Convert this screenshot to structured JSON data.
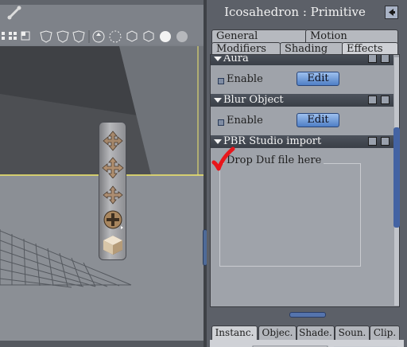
{
  "panel": {
    "title": "Icosahedron : Primitive",
    "tabs_row1": [
      "General",
      "Motion"
    ],
    "tabs_row2": [
      "Modifiers",
      "Shading",
      "Effects"
    ],
    "active_tab": "Effects"
  },
  "sections": [
    {
      "title": "Aura",
      "checkbox_label": "Enable",
      "button_label": "Edit"
    },
    {
      "title": "Blur Object",
      "checkbox_label": "Enable",
      "button_label": "Edit"
    },
    {
      "title": "PBR Studio import",
      "drop_label": "Drop Duf file here"
    }
  ],
  "bottom_tabs": [
    "Instanc.",
    "Objec.",
    "Shade.",
    "Soun.",
    "Clip."
  ],
  "colors": {
    "accent": "#4363a3",
    "checkmark": "#e8161b",
    "viewport_bg": "#7b7f86",
    "panel_bg": "#5c6068"
  },
  "toolbar_icons": [
    "grid-layout-icon",
    "layout-icon",
    "shading-icon",
    "shading-icon",
    "shading-icon",
    "navigate-icon",
    "move-icon",
    "cube-icon",
    "sphere-icon",
    "sphere-icon"
  ]
}
